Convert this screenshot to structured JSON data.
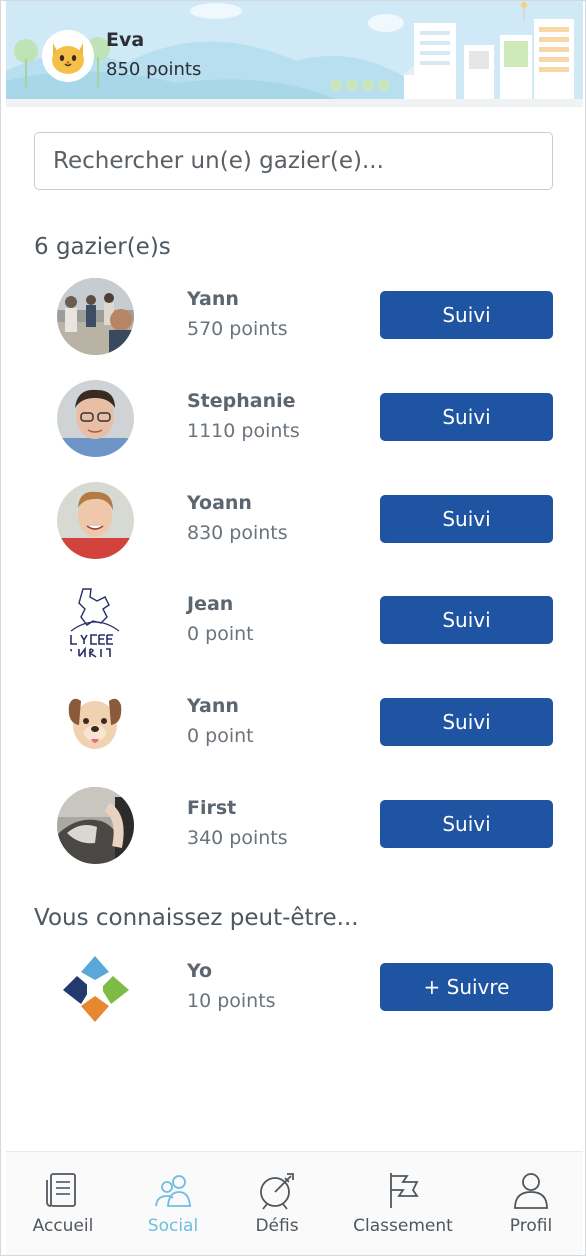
{
  "header": {
    "user_name": "Eva",
    "user_points": "850 points",
    "avatar_icon": "cat-face-icon"
  },
  "search": {
    "placeholder": "Rechercher un(e) gazier(e)..."
  },
  "following": {
    "title": "6 gazier(e)s",
    "items": [
      {
        "name": "Yann",
        "points": "570 points",
        "button": "Suivi",
        "avatar": "group-photo"
      },
      {
        "name": "Stephanie",
        "points": "1110 points",
        "button": "Suivi",
        "avatar": "man-glasses-photo"
      },
      {
        "name": "Yoann",
        "points": "830 points",
        "button": "Suivi",
        "avatar": "man-red-shirt-photo"
      },
      {
        "name": "Jean",
        "points": "0 point",
        "button": "Suivi",
        "avatar": "lycee-henri-logo"
      },
      {
        "name": "Yann",
        "points": "0 point",
        "button": "Suivi",
        "avatar": "dog-face-icon"
      },
      {
        "name": "First",
        "points": "340 points",
        "button": "Suivi",
        "avatar": "animal-photo"
      }
    ]
  },
  "suggestions": {
    "title": "Vous connaissez peut-être...",
    "items": [
      {
        "name": "Yo",
        "points": "10 points",
        "button": "+ Suivre",
        "avatar": "diamond-logo"
      }
    ]
  },
  "tabbar": {
    "active": "Social",
    "active_color": "#6cbfe0",
    "items": [
      {
        "label": "Accueil",
        "icon": "document-icon"
      },
      {
        "label": "Social",
        "icon": "people-icon"
      },
      {
        "label": "Défis",
        "icon": "target-arrow-icon"
      },
      {
        "label": "Classement",
        "icon": "flag-icon"
      },
      {
        "label": "Profil",
        "icon": "person-icon"
      }
    ]
  },
  "colors": {
    "button": "#1f54a3",
    "header_sky": "#cfeaf6"
  }
}
